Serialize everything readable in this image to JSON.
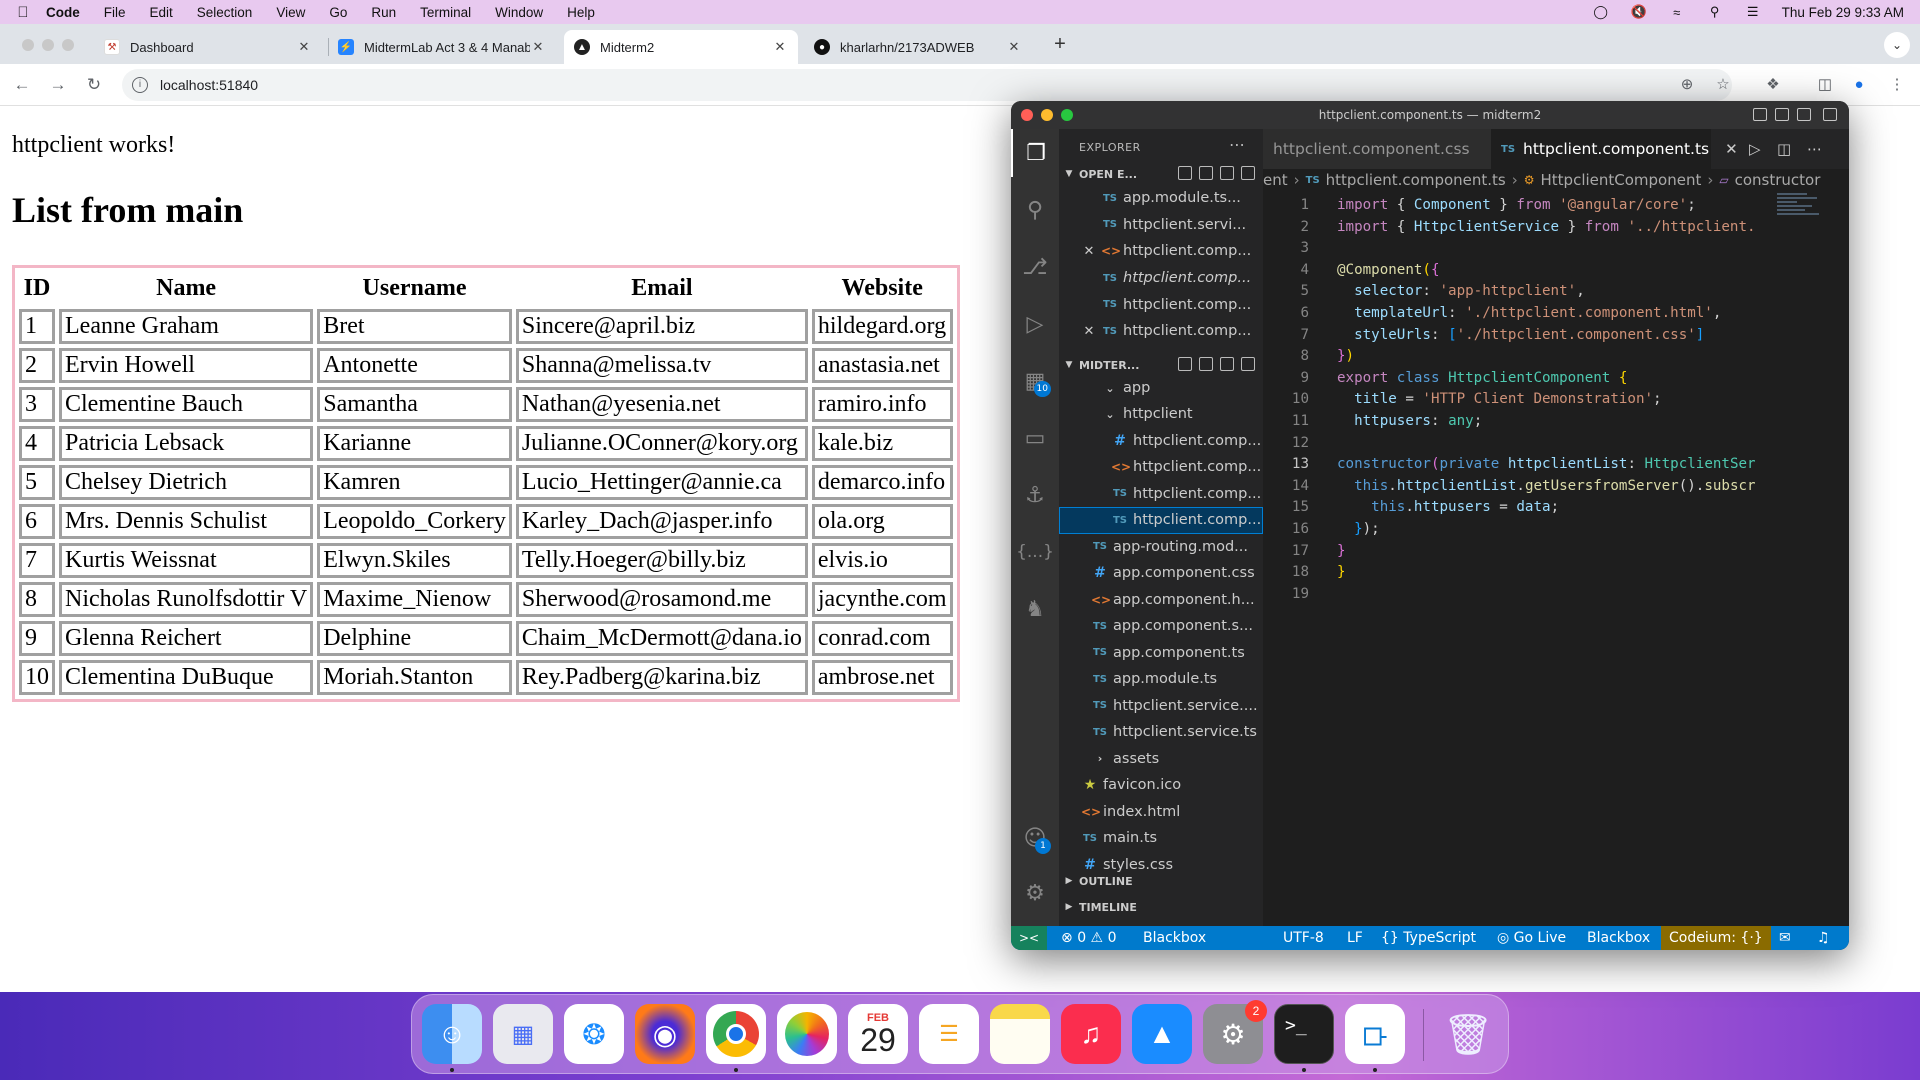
{
  "menubar": {
    "app": "Code",
    "items": [
      "File",
      "Edit",
      "Selection",
      "View",
      "Go",
      "Run",
      "Terminal",
      "Window",
      "Help"
    ],
    "datetime": "Thu Feb 29  9:33 AM"
  },
  "browser": {
    "tabs": [
      {
        "title": "Dashboard"
      },
      {
        "title": "MidtermLab Act 3 & 4 Manab"
      },
      {
        "title": "Midterm2"
      },
      {
        "title": "kharlarhn/2173ADWEB"
      }
    ],
    "url": "localhost:51840"
  },
  "page": {
    "works_text": "httpclient works!",
    "heading": "List from main",
    "table": {
      "headers": [
        "ID",
        "Name",
        "Username",
        "Email",
        "Website"
      ],
      "rows": [
        [
          "1",
          "Leanne Graham",
          "Bret",
          "Sincere@april.biz",
          "hildegard.org"
        ],
        [
          "2",
          "Ervin Howell",
          "Antonette",
          "Shanna@melissa.tv",
          "anastasia.net"
        ],
        [
          "3",
          "Clementine Bauch",
          "Samantha",
          "Nathan@yesenia.net",
          "ramiro.info"
        ],
        [
          "4",
          "Patricia Lebsack",
          "Karianne",
          "Julianne.OConner@kory.org",
          "kale.biz"
        ],
        [
          "5",
          "Chelsey Dietrich",
          "Kamren",
          "Lucio_Hettinger@annie.ca",
          "demarco.info"
        ],
        [
          "6",
          "Mrs. Dennis Schulist",
          "Leopoldo_Corkery",
          "Karley_Dach@jasper.info",
          "ola.org"
        ],
        [
          "7",
          "Kurtis Weissnat",
          "Elwyn.Skiles",
          "Telly.Hoeger@billy.biz",
          "elvis.io"
        ],
        [
          "8",
          "Nicholas Runolfsdottir V",
          "Maxime_Nienow",
          "Sherwood@rosamond.me",
          "jacynthe.com"
        ],
        [
          "9",
          "Glenna Reichert",
          "Delphine",
          "Chaim_McDermott@dana.io",
          "conrad.com"
        ],
        [
          "10",
          "Clementina DuBuque",
          "Moriah.Stanton",
          "Rey.Padberg@karina.biz",
          "ambrose.net"
        ]
      ]
    }
  },
  "vscode": {
    "window_title": "httpclient.component.ts — midterm2",
    "explorer_title": "EXPLORER",
    "open_editors_label": "OPEN E...",
    "open_editors": [
      {
        "icon": "TS",
        "name": "app.module.ts..."
      },
      {
        "icon": "TS",
        "name": "httpclient.servi..."
      },
      {
        "icon": "<>",
        "name": "httpclient.comp..."
      },
      {
        "icon": "TS",
        "name": "httpclient.comp..."
      },
      {
        "icon": "TS",
        "name": "httpclient.comp..."
      },
      {
        "icon": "TS",
        "name": "httpclient.comp..."
      }
    ],
    "project_label": "MIDTER...",
    "tree": [
      {
        "icon": "chev",
        "name": "app"
      },
      {
        "icon": "chev",
        "name": "httpclient"
      },
      {
        "icon": "#",
        "name": "httpclient.comp..."
      },
      {
        "icon": "<>",
        "name": "httpclient.comp..."
      },
      {
        "icon": "TS",
        "name": "httpclient.comp..."
      },
      {
        "icon": "TS",
        "name": "httpclient.comp..."
      },
      {
        "icon": "TS",
        "name": "app-routing.mod..."
      },
      {
        "icon": "#",
        "name": "app.component.css"
      },
      {
        "icon": "<>",
        "name": "app.component.h..."
      },
      {
        "icon": "TS",
        "name": "app.component.s..."
      },
      {
        "icon": "TS",
        "name": "app.component.ts"
      },
      {
        "icon": "TS",
        "name": "app.module.ts"
      },
      {
        "icon": "TS",
        "name": "httpclient.service...."
      },
      {
        "icon": "TS",
        "name": "httpclient.service.ts"
      },
      {
        "icon": "chev",
        "name": "assets"
      },
      {
        "icon": "star",
        "name": "favicon.ico"
      },
      {
        "icon": "<>",
        "name": "index.html"
      },
      {
        "icon": "TS",
        "name": "main.ts"
      },
      {
        "icon": "#",
        "name": "styles.css"
      }
    ],
    "outline_label": "OUTLINE",
    "timeline_label": "TIMELINE",
    "tabs": {
      "inactive": "httpclient.component.css",
      "active": "httpclient.component.ts"
    },
    "breadcrumb": {
      "part1": "ent",
      "part2": "httpclient.component.ts",
      "part3": "HttpclientComponent",
      "part4": "constructor"
    },
    "badges": {
      "extensions": "10",
      "accounts": "1"
    },
    "line_numbers": [
      "1",
      "2",
      "3",
      "4",
      "5",
      "6",
      "7",
      "8",
      "9",
      "10",
      "11",
      "12",
      "13",
      "14",
      "15",
      "16",
      "17",
      "18",
      "19"
    ],
    "code": {
      "l1": {
        "a": "import",
        "b": " { ",
        "c": "Component",
        "d": " } ",
        "e": "from",
        "f": " ",
        "g": "'@angular/core'",
        "h": ";"
      },
      "l2": {
        "a": "import",
        "b": " { ",
        "c": "HttpclientService",
        "d": " } ",
        "e": "from",
        "f": " ",
        "g": "'../httpclient."
      },
      "l4": {
        "a": "@",
        "b": "Component",
        "c": "(",
        "d": "{"
      },
      "l5": {
        "a": "  selector",
        "b": ": ",
        "c": "'app-httpclient'",
        "d": ","
      },
      "l6": {
        "a": "  templateUrl",
        "b": ": ",
        "c": "'./httpclient.component.html'",
        "d": ","
      },
      "l7": {
        "a": "  styleUrls",
        "b": ": ",
        "c": "[",
        "d": "'./httpclient.component.css'",
        "e": "]"
      },
      "l8": {
        "a": "}",
        "b": ")"
      },
      "l9": {
        "a": "export",
        "b": " ",
        "c": "class",
        "d": " ",
        "e": "HttpclientComponent",
        "f": " ",
        "g": "{"
      },
      "l10": {
        "a": "  title",
        "b": " = ",
        "c": "'HTTP Client Demonstration'",
        "d": ";"
      },
      "l11": {
        "a": "  httpusers",
        "b": ": ",
        "c": "any",
        "d": ";"
      },
      "l13": {
        "a": "constructor",
        "b": "(",
        "c": "private",
        "d": " ",
        "e": "httpclientList",
        "f": ": ",
        "g": "HttpclientSer"
      },
      "l14": {
        "a": "  ",
        "b": "this",
        "c": ".",
        "d": "httpclientList",
        "e": ".",
        "f": "getUsersfromServer",
        "g": "().",
        "h": "subscr"
      },
      "l15": {
        "a": "    ",
        "b": "this",
        "c": ".",
        "d": "httpusers",
        "e": " = ",
        "f": "data",
        "g": ";"
      },
      "l16": {
        "a": "  ",
        "b": "}",
        "c": ");"
      },
      "l17": {
        "a": "}"
      },
      "l18": {
        "a": "}"
      }
    },
    "status": {
      "errors": "0",
      "warnings": "0",
      "blackbox1": "Blackbox",
      "encoding": "UTF-8",
      "eol": "LF",
      "language": "TypeScript",
      "golive": "Go Live",
      "blackbox2": "Blackbox",
      "codeium": "Codeium: {·}"
    }
  },
  "dock": {
    "calendar_month": "FEB",
    "calendar_day": "29",
    "settings_badge": "2",
    "terminal_glyph": ">_"
  }
}
